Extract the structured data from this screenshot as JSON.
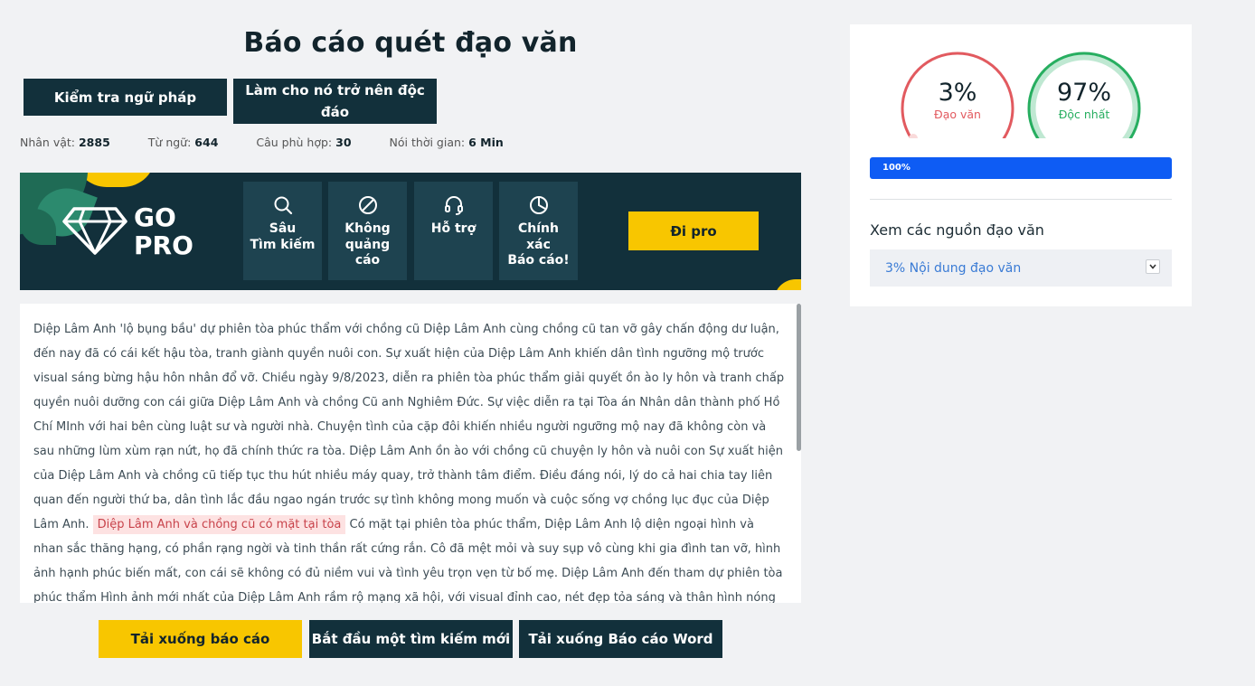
{
  "title": "Báo cáo quét đạo văn",
  "actions": {
    "grammar": "Kiểm tra ngữ pháp",
    "unique": "Làm cho nó trở nên độc đáo"
  },
  "stats": [
    {
      "label": "Nhân vật:",
      "value": "2885"
    },
    {
      "label": "Từ ngữ:",
      "value": "644"
    },
    {
      "label": "Câu phù hợp:",
      "value": "30"
    },
    {
      "label": "Nói thời gian:",
      "value": "6 Min"
    }
  ],
  "banner": {
    "logo_line1": "GO",
    "logo_line2": "PRO",
    "features": [
      {
        "icon": "search-icon",
        "label_lines": [
          "Sâu",
          "Tìm kiếm"
        ]
      },
      {
        "icon": "no-ads-icon",
        "label_lines": [
          "Không",
          "quảng",
          "cáo"
        ]
      },
      {
        "icon": "headset-icon",
        "label_lines": [
          "Hỗ trợ"
        ]
      },
      {
        "icon": "pie-chart-icon",
        "label_lines": [
          "Chính",
          "xác",
          "Báo cáo!"
        ]
      }
    ],
    "go_pro_button": "Đi pro",
    "colors": {
      "background": "#12303b",
      "accent": "#f8c600"
    }
  },
  "report_text": {
    "before_highlight": "Diệp Lâm Anh 'lộ bụng bầu' dự phiên tòa phúc thẩm với chồng cũ Diệp Lâm Anh cùng chồng cũ tan vỡ gây chấn động dư luận, đến nay đã có cái kết hậu tòa, tranh giành quyền nuôi con. Sự xuất hiện của Diệp Lâm Anh khiến dân tình ngưỡng mộ trước visual sáng bừng hậu hôn nhân đổ vỡ. Chiều ngày 9/8/2023, diễn ra phiên tòa phúc thẩm giải quyết ồn ào ly hôn và tranh chấp quyền nuôi dưỡng con cái giữa Diệp Lâm Anh và chồng Cũ anh Nghiêm Đức. Sự việc diễn ra tại Tòa án Nhân dân thành phố Hồ Chí MInh với hai bên cùng luật sư và người nhà. Chuyện tình của cặp đôi khiến nhiều người ngưỡng mộ nay đã không còn và sau những lùm xùm rạn nứt, họ đã chính thức ra tòa. Diệp Lâm Anh ồn ào với chồng cũ chuyện ly hôn và nuôi con Sự xuất hiện của Diệp Lâm Anh và chồng cũ tiếp tục thu hút nhiều máy quay, trở thành tâm điểm. Điều đáng nói, lý do cả hai chia tay liên quan đến người thứ ba, dân tình lắc đầu ngao ngán trước sự tình không mong muốn và cuộc sống vợ chồng lục đục của Diệp Lâm Anh. ",
    "highlight": "Diệp Lâm Anh và chồng cũ có mặt tại tòa",
    "after_highlight": " Có mặt tại phiên tòa phúc thẩm, Diệp Lâm Anh lộ diện ngoại hình và nhan sắc thăng hạng, có phần rạng ngời và tinh thần rất cứng rắn. Cô đã mệt mỏi và suy sụp vô cùng khi gia đình tan vỡ, hình ảnh hạnh phúc biến mất, con cái sẽ không có đủ niềm vui và tình yêu trọn vẹn từ bố mẹ. Diệp Lâm Anh đến tham dự phiên tòa phúc thẩm Hình ảnh mới nhất của Diệp Lâm Anh rầm rộ mạng xã hội, với visual đỉnh cao, nét đẹp tỏa sáng và thân hình nóng bỏng."
  },
  "bottom_buttons": {
    "download": "Tải xuống báo cáo",
    "new_search": "Bắt đầu một tìm kiếm mới",
    "word": "Tải xuống Báo cáo Word"
  },
  "results": {
    "plagiarism_pct": "3%",
    "plagiarism_label": "Đạo văn",
    "plagiarism_value": 3,
    "unique_pct": "97%",
    "unique_label": "Độc nhất",
    "unique_value": 97,
    "progress_label": "100%",
    "progress_value": 100,
    "sources_title": "Xem các nguồn đạo văn",
    "sources_dropdown": "3% Nội dung đạo văn",
    "colors": {
      "plagiarism": "#e25a5f",
      "unique": "#27ae60",
      "progress": "#0e5cf4"
    }
  }
}
